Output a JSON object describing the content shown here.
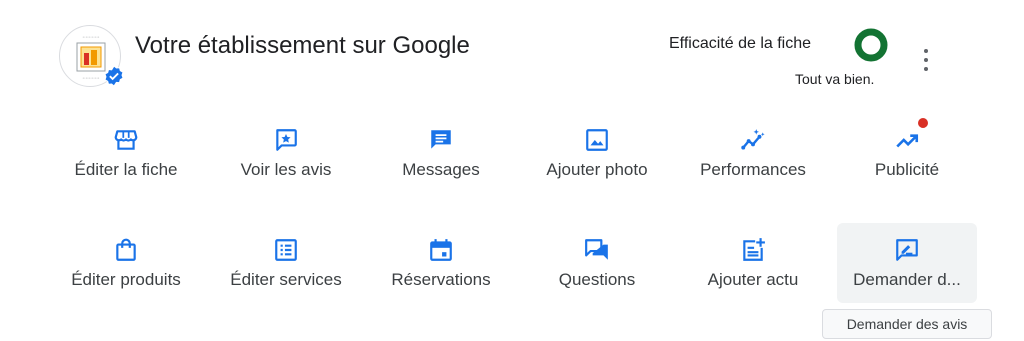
{
  "header": {
    "title": "Votre établissement sur Google",
    "avatar_icon": "business-logo",
    "verified_icon": "verified-badge-icon"
  },
  "efficacy": {
    "label": "Efficacité de la fiche",
    "status": "Tout va bien.",
    "ring_color": "#137333",
    "level": 1.0
  },
  "menu_icon": "more-vertical-icon",
  "accent_color": "#1a73e8",
  "notification_dot_color": "#d93025",
  "actions_row1": [
    {
      "label": "Éditer la fiche",
      "icon": "storefront-icon"
    },
    {
      "label": "Voir les avis",
      "icon": "review-star-icon"
    },
    {
      "label": "Messages",
      "icon": "message-icon"
    },
    {
      "label": "Ajouter photo",
      "icon": "add-photo-icon"
    },
    {
      "label": "Performances",
      "icon": "insights-icon"
    },
    {
      "label": "Publicité",
      "icon": "trending-up-icon"
    }
  ],
  "actions_row2": [
    {
      "label": "Éditer produits",
      "icon": "shopping-bag-icon"
    },
    {
      "label": "Éditer services",
      "icon": "list-icon"
    },
    {
      "label": "Réservations",
      "icon": "calendar-icon"
    },
    {
      "label": "Questions",
      "icon": "forum-icon"
    },
    {
      "label": "Ajouter actu",
      "icon": "post-add-icon"
    },
    {
      "label": "Demander d...",
      "icon": "rate-review-icon"
    }
  ],
  "tooltip": "Demander des avis"
}
